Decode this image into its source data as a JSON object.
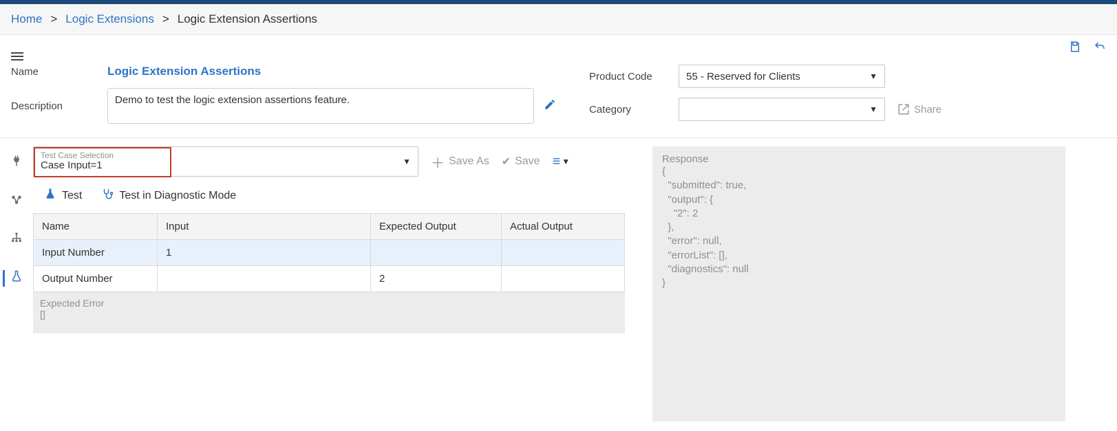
{
  "breadcrumb": {
    "home": "Home",
    "logic_ext": "Logic Extensions",
    "current": "Logic Extension Assertions"
  },
  "form": {
    "name_label": "Name",
    "name_value": "Logic Extension Assertions",
    "desc_label": "Description",
    "desc_value": "Demo to test the logic extension assertions feature.",
    "product_code_label": "Product Code",
    "product_code_value": "55 - Reserved for Clients",
    "category_label": "Category",
    "category_value": "",
    "share_label": "Share"
  },
  "toolbar": {
    "tcs_label": "Test Case Selection",
    "tcs_value": "Case Input=1",
    "save_as": "Save As",
    "save": "Save"
  },
  "tests": {
    "test_label": "Test",
    "diag_label": "Test in Diagnostic Mode"
  },
  "grid": {
    "headers": {
      "name": "Name",
      "input": "Input",
      "expected": "Expected Output",
      "actual": "Actual Output"
    },
    "rows": [
      {
        "name": "Input Number",
        "input": "1",
        "expected": "",
        "actual": ""
      },
      {
        "name": "Output Number",
        "input": "",
        "expected": "2",
        "actual": ""
      }
    ],
    "expected_error_label": "Expected Error",
    "expected_error_value": "[]"
  },
  "response": {
    "label": "Response",
    "body": "{\n  \"submitted\": true,\n  \"output\": {\n    \"2\": 2\n  },\n  \"error\": null,\n  \"errorList\": [],\n  \"diagnostics\": null\n}"
  }
}
